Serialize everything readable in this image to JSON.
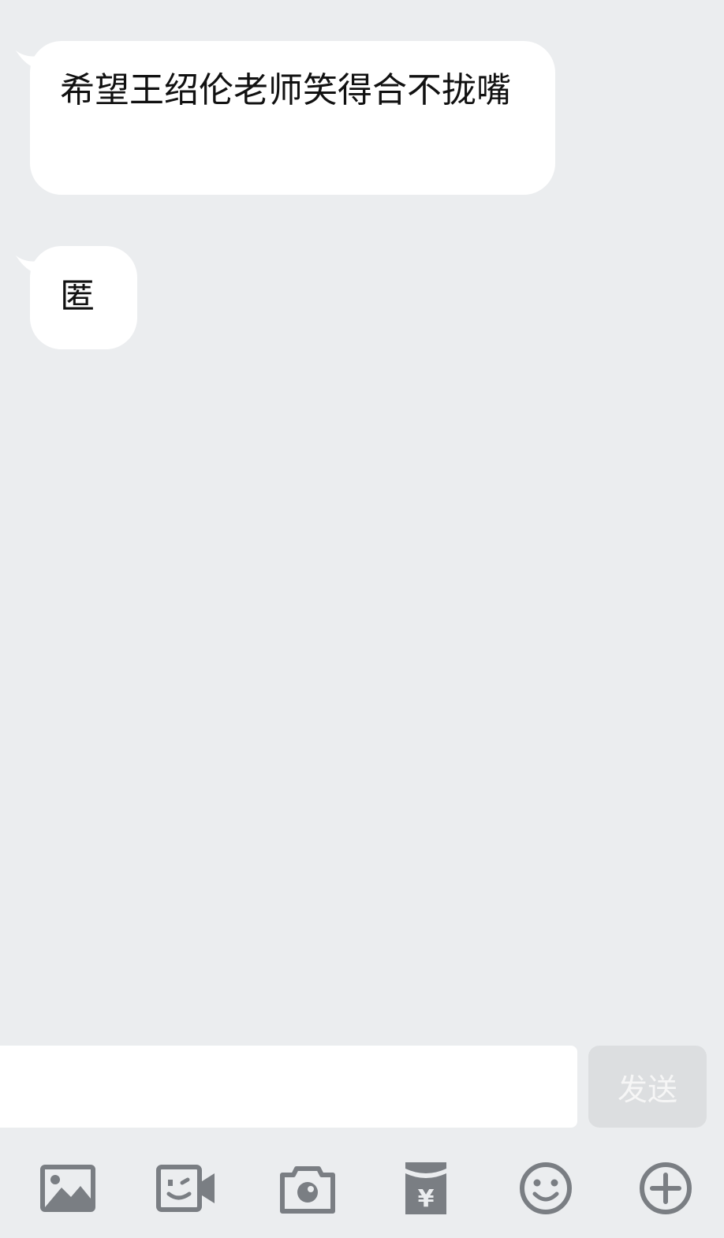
{
  "messages": [
    {
      "text": "希望王绍伦老师笑得合不拢嘴"
    },
    {
      "text": "匿"
    }
  ],
  "input": {
    "value": "",
    "placeholder": ""
  },
  "send_button": {
    "label": "发送"
  },
  "toolbar": [
    {
      "icon": "image-icon"
    },
    {
      "icon": "video-call-icon"
    },
    {
      "icon": "camera-icon"
    },
    {
      "icon": "red-packet-icon"
    },
    {
      "icon": "emoji-icon"
    },
    {
      "icon": "plus-icon"
    }
  ],
  "colors": {
    "background": "#ebedef",
    "bubble": "#ffffff",
    "icon": "#7a7e83",
    "send_disabled": "#dcdee0"
  }
}
